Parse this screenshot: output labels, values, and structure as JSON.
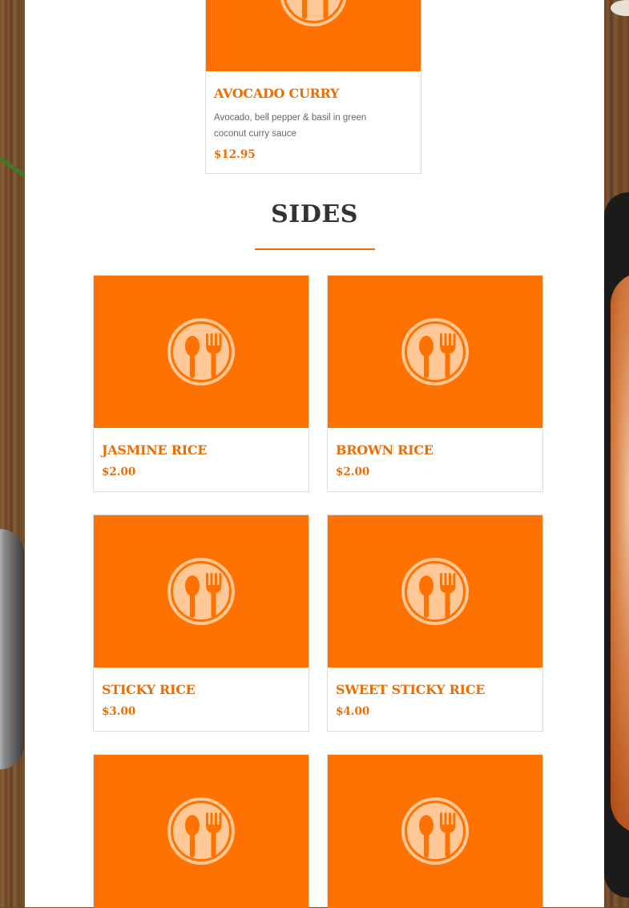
{
  "colors": {
    "accent": "#ef6c00",
    "card_image_bg": "#ff7200",
    "icon_fill": "#ffc896"
  },
  "top_item": {
    "name": "AVOCADO CURRY",
    "description": "Avocado, bell pepper & basil in green coconut curry sauce",
    "price": "$12.95",
    "icon": "spoon-fork-plate-icon"
  },
  "sides": {
    "heading": "SIDES",
    "items": [
      {
        "name": "JASMINE RICE",
        "price": "$2.00",
        "icon": "spoon-fork-plate-icon"
      },
      {
        "name": "BROWN RICE",
        "price": "$2.00",
        "icon": "spoon-fork-plate-icon"
      },
      {
        "name": "STICKY RICE",
        "price": "$3.00",
        "icon": "spoon-fork-plate-icon"
      },
      {
        "name": "SWEET STICKY RICE",
        "price": "$4.00",
        "icon": "spoon-fork-plate-icon"
      },
      {
        "name": "",
        "price": "",
        "icon": "spoon-fork-plate-icon"
      },
      {
        "name": "",
        "price": "",
        "icon": "spoon-fork-plate-icon"
      }
    ]
  }
}
